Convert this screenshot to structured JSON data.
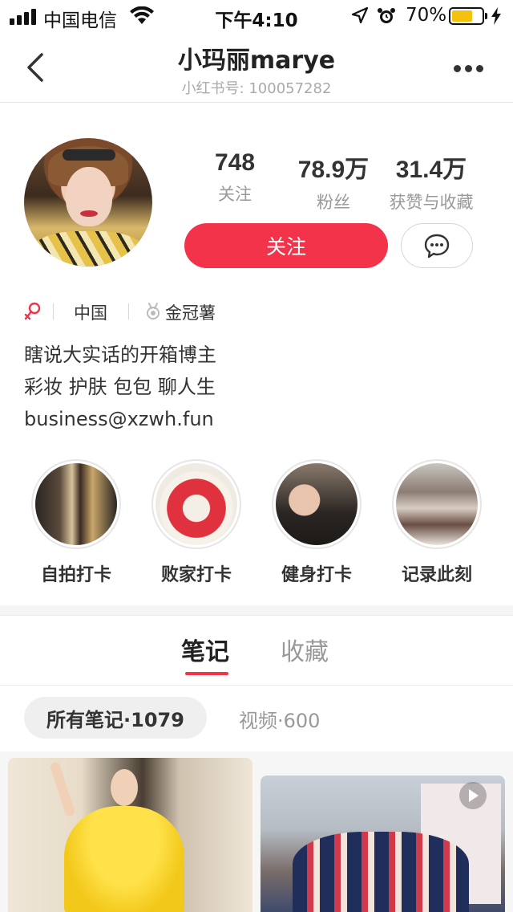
{
  "status_bar": {
    "carrier": "中国电信",
    "time": "下午4:10",
    "battery_percent": "70%",
    "battery_level": 0.7,
    "battery_color": "#f4c20d"
  },
  "nav": {
    "back_icon": "chevron-left-icon",
    "title": "小玛丽marye",
    "subtitle": "小红书号: 100057282",
    "more_icon": "more-dots-icon"
  },
  "profile": {
    "stats": [
      {
        "value": "748",
        "label": "关注"
      },
      {
        "value": "78.9万",
        "label": "粉丝"
      },
      {
        "value": "31.4万",
        "label": "获赞与收藏"
      }
    ],
    "follow_label": "关注",
    "message_icon": "chat-bubble-icon",
    "accent_color": "#f2334a",
    "gender_icon": "female-icon",
    "location": "中国",
    "badge": "金冠薯",
    "bio": [
      "瞎说大实话的开箱博主",
      "彩妆 护肤 包包 聊人生",
      "business@xzwh.fun"
    ]
  },
  "highlights": [
    {
      "label": "自拍打卡"
    },
    {
      "label": "败家打卡"
    },
    {
      "label": "健身打卡"
    },
    {
      "label": "记录此刻"
    }
  ],
  "tabs": {
    "notes": "笔记",
    "collections": "收藏"
  },
  "filters": {
    "all": "所有笔记·1079",
    "video": "视频·600"
  }
}
